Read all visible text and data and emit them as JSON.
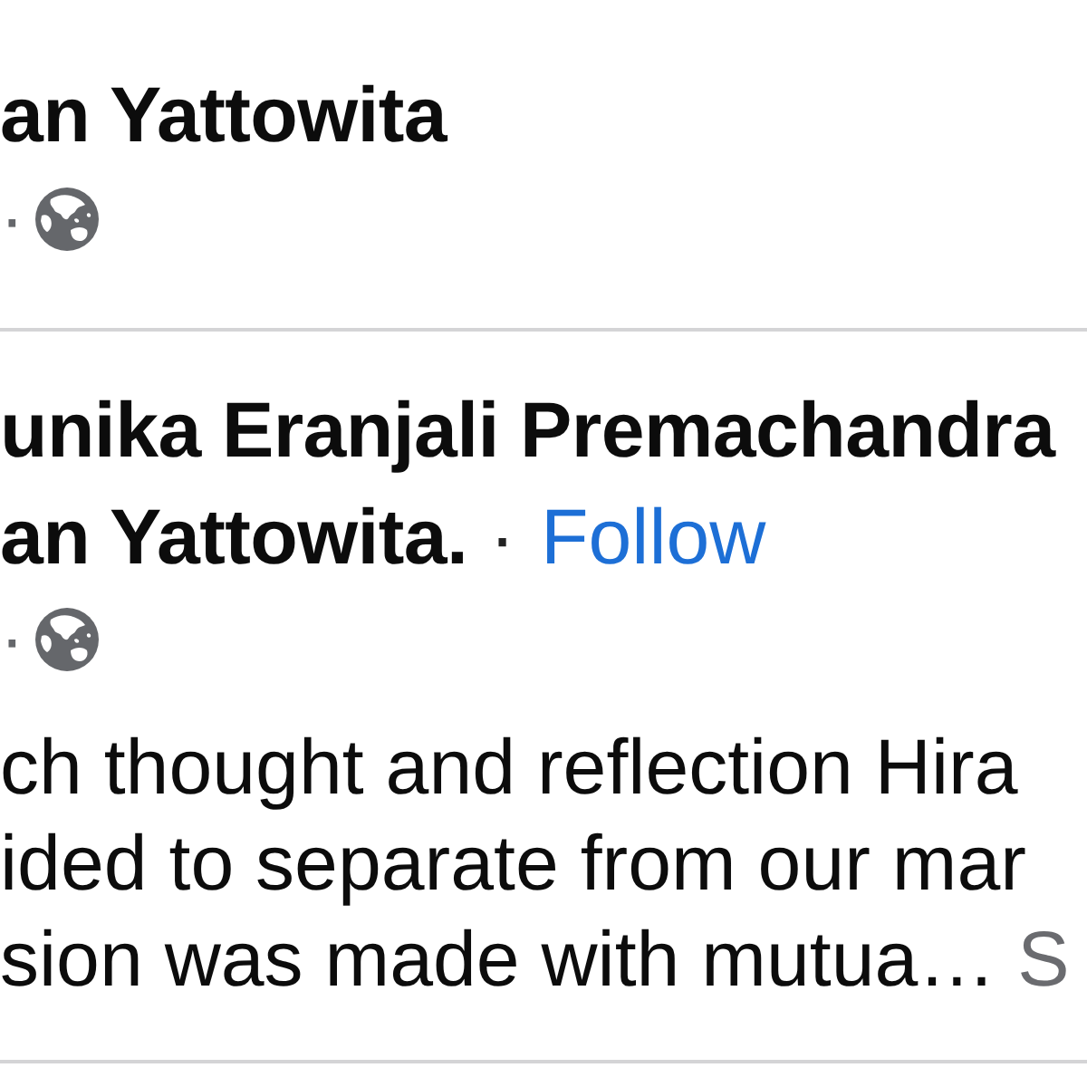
{
  "posts": [
    {
      "author": "an Yattowita",
      "meta_separator": "·"
    },
    {
      "author": "unika Eranjali Premachandra",
      "tagged": "an Yattowita.",
      "separator": "·",
      "follow": "Follow",
      "meta_separator": "·",
      "text_lines": [
        "ch thought and reflection Hira",
        "ided to separate from our mar",
        "sion was made with mutua…"
      ],
      "see_more": "S"
    }
  ]
}
